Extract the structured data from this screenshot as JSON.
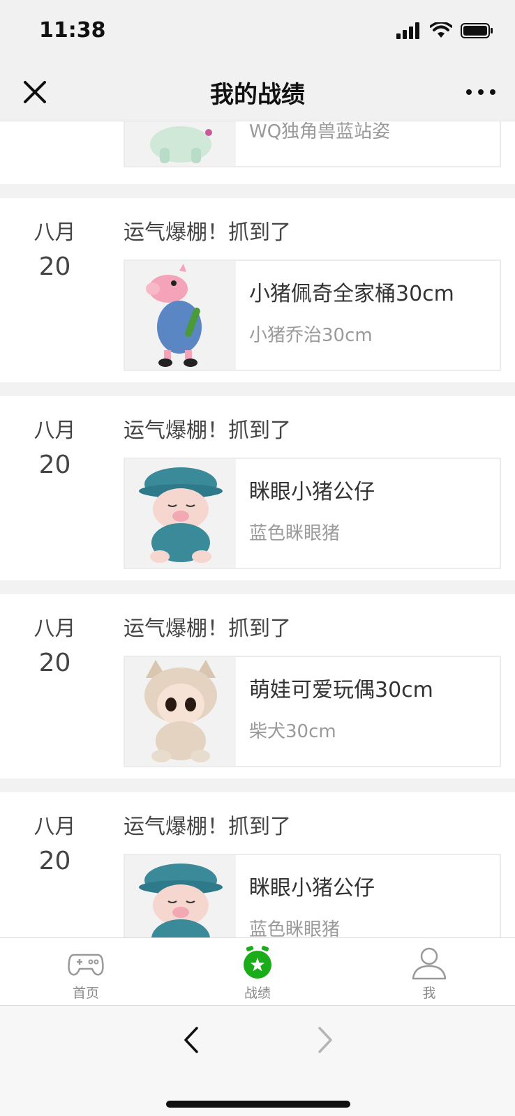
{
  "status_bar": {
    "time": "11:38"
  },
  "nav": {
    "title": "我的战绩"
  },
  "partial_top": {
    "sub": "WQ独角兽蓝站姿"
  },
  "records": [
    {
      "month": "八月",
      "day": "20",
      "caption": "运气爆棚！抓到了",
      "name": "小猪佩奇全家桶30cm",
      "sub": "小猪乔治30cm",
      "image": "peppa-george-plush"
    },
    {
      "month": "八月",
      "day": "20",
      "caption": "运气爆棚！抓到了",
      "name": "眯眼小猪公仔",
      "sub": "蓝色眯眼猪",
      "image": "blue-hat-pig-plush"
    },
    {
      "month": "八月",
      "day": "20",
      "caption": "运气爆棚！抓到了",
      "name": "萌娃可爱玩偶30cm",
      "sub": "柴犬30cm",
      "image": "shiba-doll-plush"
    },
    {
      "month": "八月",
      "day": "20",
      "caption": "运气爆棚！抓到了",
      "name": "眯眼小猪公仔",
      "sub": "蓝色眯眼猪",
      "image": "blue-hat-pig-plush"
    }
  ],
  "tabs": [
    {
      "label": "首页",
      "icon": "gamepad-icon"
    },
    {
      "label": "战绩",
      "icon": "alarm-star-icon",
      "active": true
    },
    {
      "label": "我",
      "icon": "person-icon"
    }
  ],
  "colors": {
    "accent": "#1aad19",
    "background": "#f2f2f2",
    "muted_text": "#9a9a9a"
  }
}
